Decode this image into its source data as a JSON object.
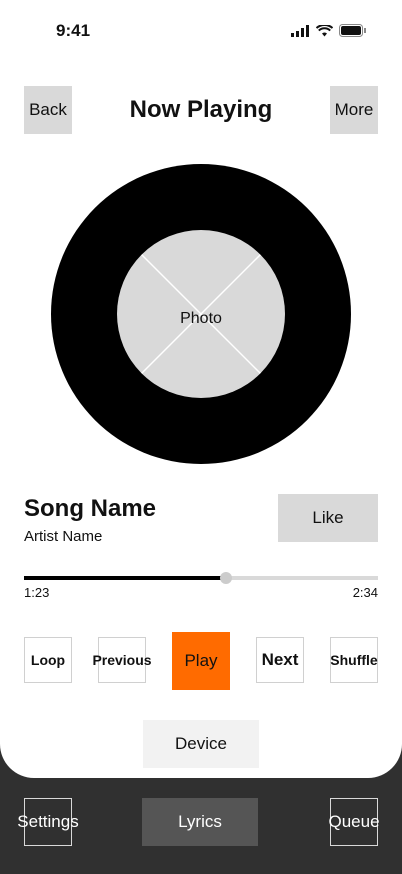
{
  "status_bar": {
    "time": "9:41"
  },
  "header": {
    "back_label": "Back",
    "title": "Now Playing",
    "more_label": "More"
  },
  "artwork": {
    "photo_label": "Photo"
  },
  "track": {
    "song_name": "Song Name",
    "artist_name": "Artist Name",
    "like_label": "Like",
    "elapsed": "1:23",
    "total": "2:34",
    "progress_percent": 57
  },
  "controls": {
    "loop_label": "Loop",
    "previous_label": "Previous",
    "play_label": "Play",
    "next_label": "Next",
    "shuffle_label": "Shuffle",
    "play_color": "#ff6b00"
  },
  "device": {
    "label": "Device"
  },
  "tab_bar": {
    "settings_label": "Settings",
    "lyrics_label": "Lyrics",
    "queue_label": "Queue"
  }
}
